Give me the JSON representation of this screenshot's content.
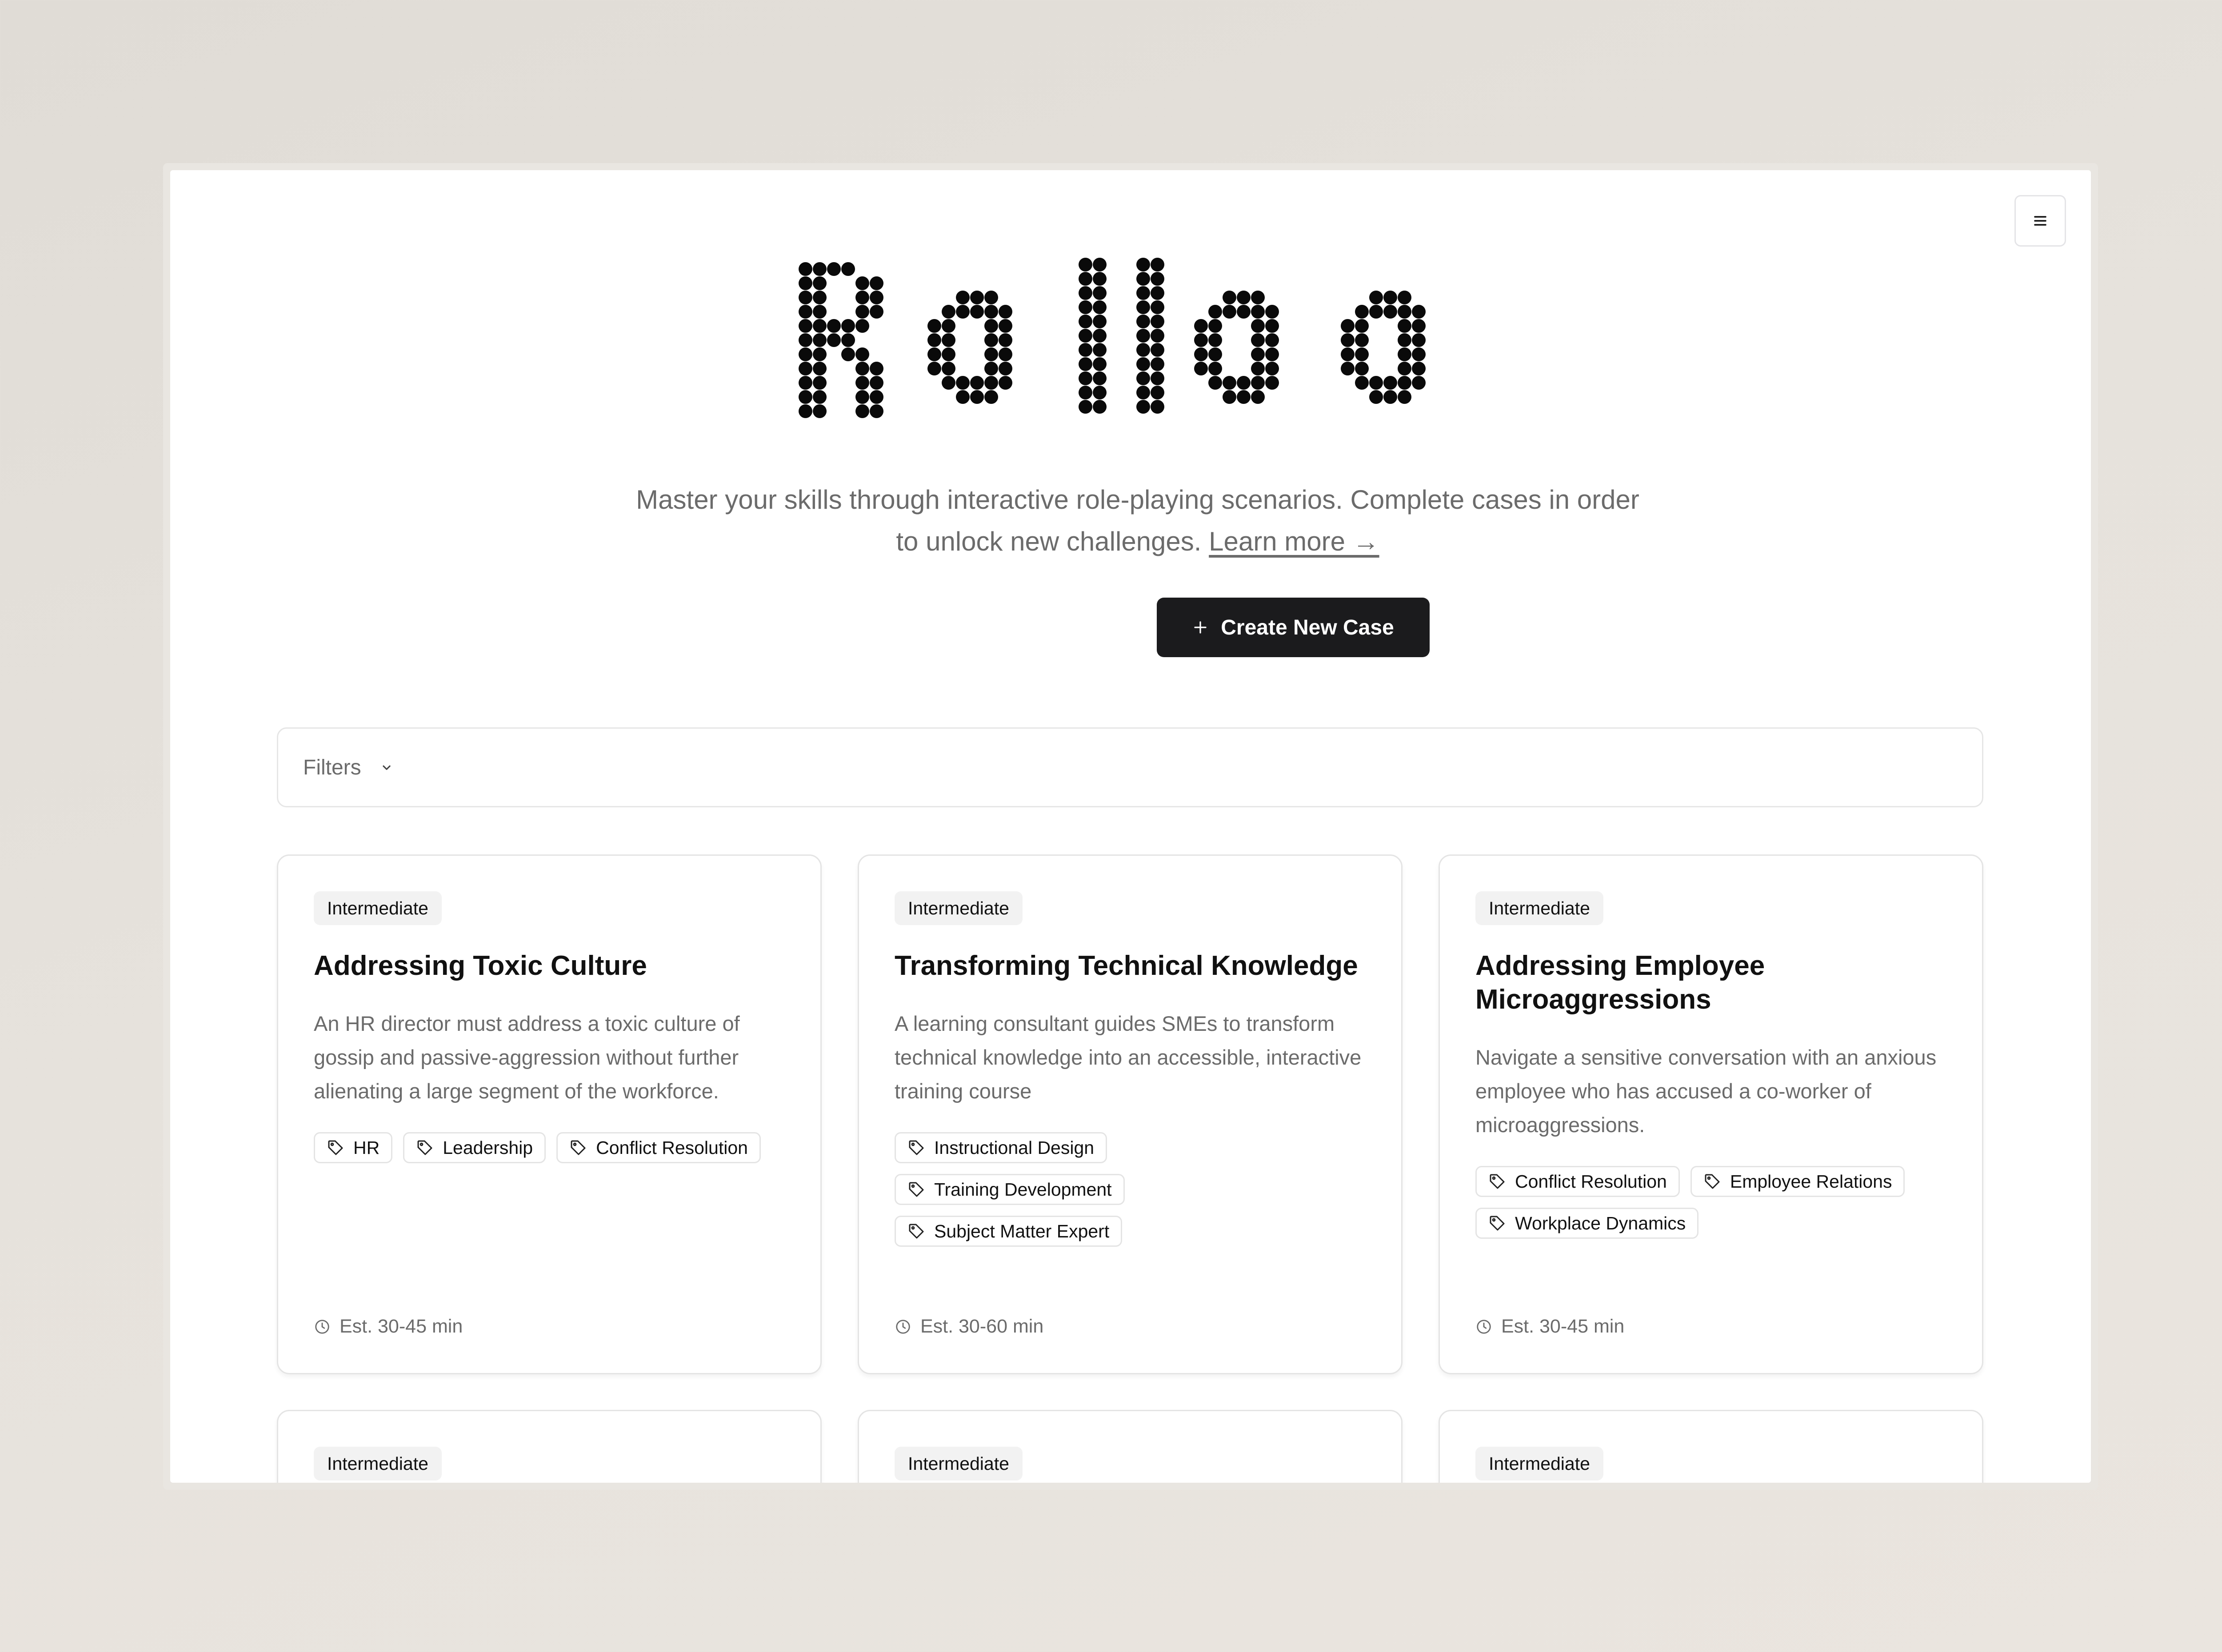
{
  "app": {
    "logo_text": "Rolloo"
  },
  "header": {
    "tagline": "Master your skills through interactive role-playing scenarios. Complete cases in order to unlock new challenges.",
    "learn_more": "Learn more →",
    "create_button": "Create New Case",
    "menu_icon": "hamburger-menu-icon"
  },
  "filters": {
    "label": "Filters",
    "icon": "chevron-down-icon"
  },
  "cards": [
    {
      "level": "Intermediate",
      "title": "Addressing Toxic Culture",
      "description": "An HR director must address a toxic culture of gossip and passive-aggression without further alienating a large segment of the workforce.",
      "tags": [
        "HR",
        "Leadership",
        "Conflict Resolution"
      ],
      "estimate": "Est. 30-45 min"
    },
    {
      "level": "Intermediate",
      "title": "Transforming Technical Knowledge",
      "description": "A learning consultant guides SMEs to transform technical knowledge into an accessible, interactive training course",
      "tags": [
        "Instructional Design",
        "Training Development",
        "Subject Matter Expert"
      ],
      "estimate": "Est. 30-60 min"
    },
    {
      "level": "Intermediate",
      "title": "Addressing Employee Microaggressions",
      "description": "Navigate a sensitive conversation with an anxious employee who has accused a co-worker of microaggressions.",
      "tags": [
        "Conflict Resolution",
        "Employee Relations",
        "Workplace Dynamics"
      ],
      "estimate": "Est. 30-45 min"
    },
    {
      "level": "Intermediate"
    },
    {
      "level": "Intermediate"
    },
    {
      "level": "Intermediate"
    }
  ]
}
